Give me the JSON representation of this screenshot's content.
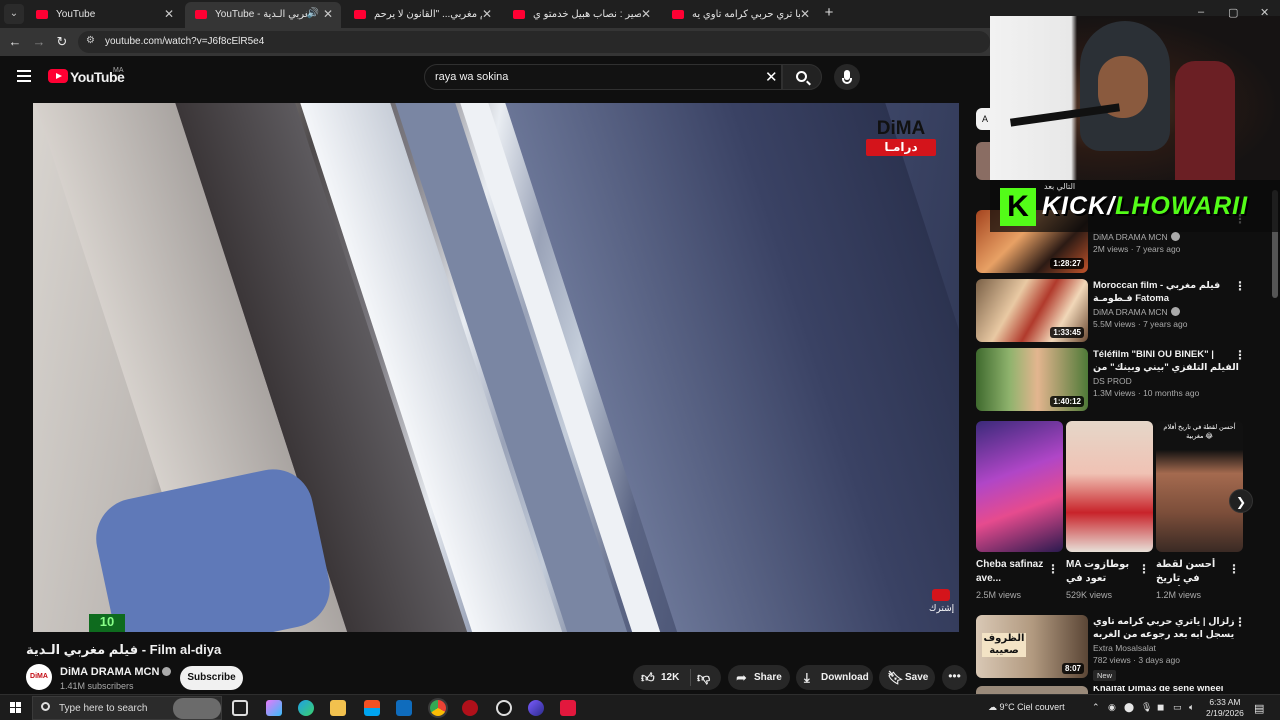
{
  "browser": {
    "tabs": [
      {
        "title": "YouTube",
        "active": false
      },
      {
        "title": "YouTube - فيلم مغربي الـدية",
        "active": true
      },
      {
        "title": "فيلم مغربي... \"القانون لا يرحم \"",
        "active": false
      },
      {
        "title": "فيلم قصير : نصاب هبيل خدمتو ي...",
        "active": false
      },
      {
        "title": "زلزال ا يا تري حربي كرامه تاوي يه...",
        "active": false
      }
    ],
    "new_tab": "+",
    "url": "youtube.com/watch?v=J6f8cElR5e4"
  },
  "youtube": {
    "logo_text": "YouTube",
    "region": "MA",
    "search_query": "raya wa sokina"
  },
  "player": {
    "logo_top": "DiMA",
    "logo_bottom": "درامـا",
    "subscribe_watermark": "إشترك",
    "channel_number": "10"
  },
  "video": {
    "title": "فيلم مغربي الـدية - Film al-diya",
    "channel": "DiMA DRAMA MCN",
    "channel_avatar": "DiMA",
    "subscribers": "1.41M subscribers",
    "subscribe_label": "Subscribe",
    "likes": "12K",
    "share_label": "Share",
    "download_label": "Download",
    "save_label": "Save"
  },
  "sidebar": {
    "chip_label": "A",
    "videos": [
      {
        "duration": "1:28:27",
        "title": "",
        "channel": "DiMA DRAMA MCN",
        "views": "2M views · 7 years ago"
      },
      {
        "duration": "1:33:45",
        "title": "Moroccan film - فيلم مغربي فـطومـة Fatoma",
        "channel": "DiMA DRAMA MCN",
        "views": "5.5M views · 7 years ago"
      },
      {
        "duration": "1:40:12",
        "title": "Téléfilm \"BINI OU BINEK\" | الفيلم التلفزي \"بيني وبينك\" من إخراج فريس ...",
        "channel": "DS PROD",
        "views": "1.3M views · 10 months ago"
      }
    ],
    "shorts": [
      {
        "title": "Cheba safinaz ave...",
        "views": "2.5M views"
      },
      {
        "title": "MA بوطازوت تعود في رمضان",
        "views": "529K views"
      },
      {
        "title": "أحسن لقطة في تاريخ أفلام...",
        "views": "1.2M views",
        "overlay": "أحسن لقطة في تاريخ أفلام مغربية 😂"
      }
    ],
    "last_video": {
      "duration": "8:07",
      "thumb_text": "الظروف صعيبة",
      "title": "زلزال | ياتري حربي كرامه تاوي يسجل ابه بعد رجوعه من الغربه",
      "channel": "Extra Mosalsalat",
      "views": "782 views · 3 days ago",
      "badge": "New"
    },
    "peek_title": "Khalfat Dima3 de sene wheel"
  },
  "stream_overlay": {
    "logo": "K",
    "prefix": "KICK/",
    "handle": "LHOWARII",
    "now_playing": "التالي بعد"
  },
  "taskbar": {
    "search_placeholder": "Type here to search",
    "weather": "9°C  Ciel couvert",
    "time": "6:33 AM",
    "date": "2/19/2026"
  },
  "colors": {
    "yt_red": "#ff0033",
    "kick_green": "#53fc18",
    "background": "#0f0f0f"
  }
}
